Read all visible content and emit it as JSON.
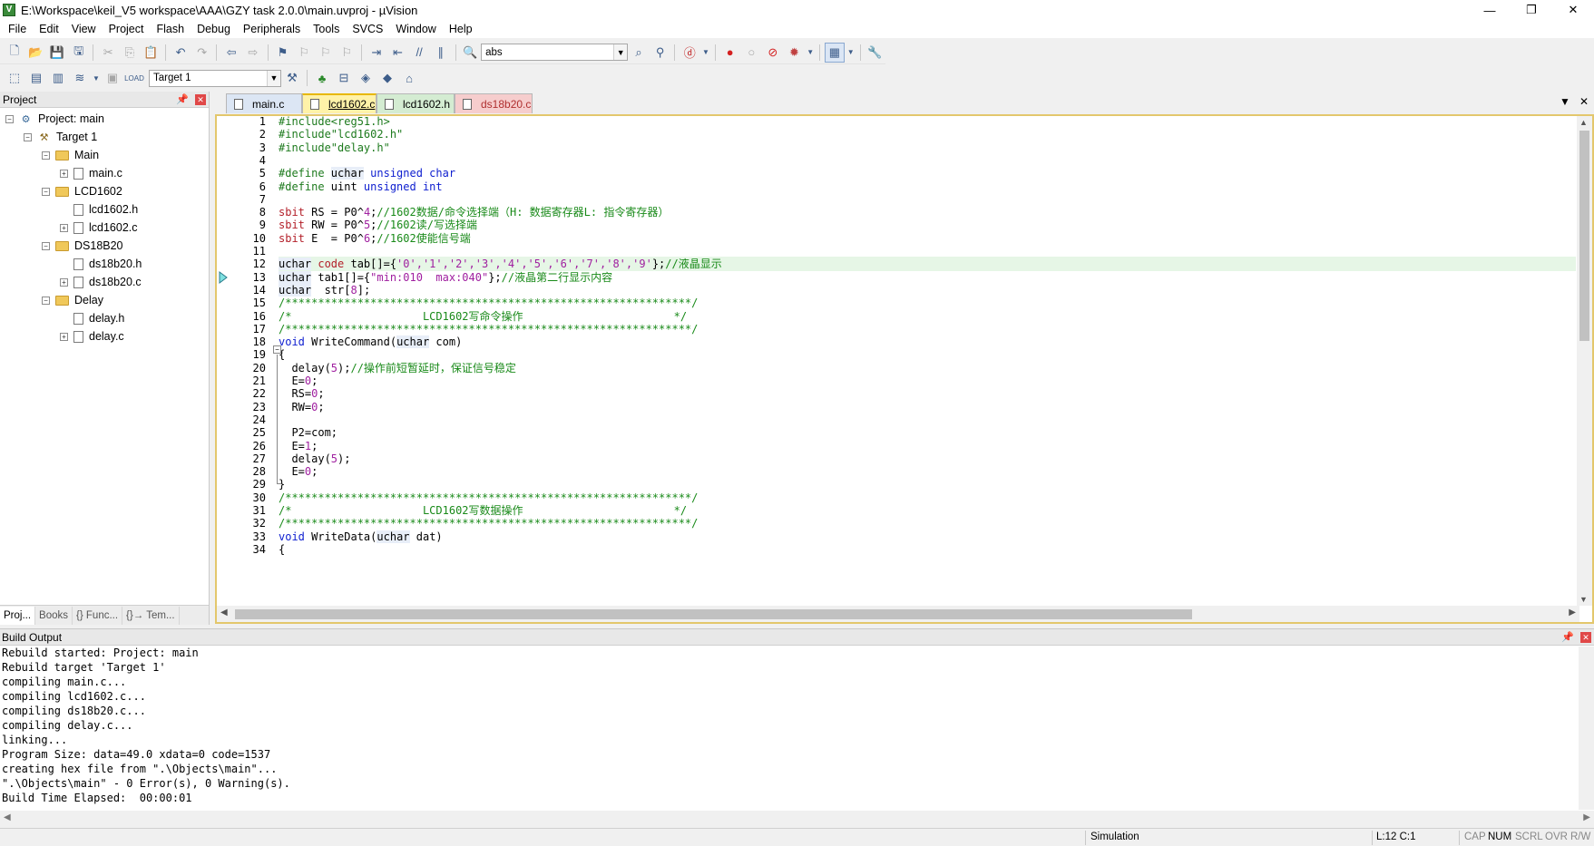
{
  "window": {
    "title": "E:\\Workspace\\keil_V5 workspace\\AAA\\GZY task 2.0.0\\main.uvproj - µVision",
    "minimize": "—",
    "restore": "❐",
    "close": "✕"
  },
  "menu": [
    "File",
    "Edit",
    "View",
    "Project",
    "Flash",
    "Debug",
    "Peripherals",
    "Tools",
    "SVCS",
    "Window",
    "Help"
  ],
  "toolbar": {
    "find_combo_value": "abs",
    "target_combo_value": "Target 1",
    "icons": [
      "new-file-icon",
      "open-icon",
      "save-icon",
      "save-all-icon",
      "cut-icon",
      "copy-icon",
      "paste-icon",
      "undo-icon",
      "redo-icon",
      "nav-back-icon",
      "nav-forward-icon",
      "bookmark-icon",
      "prev-bookmark-icon",
      "next-bookmark-icon",
      "clear-bookmarks-icon",
      "indent-icon",
      "unindent-icon",
      "comment-icon",
      "uncomment-icon",
      "find-in-files-icon"
    ]
  },
  "project_pane": {
    "title": "Project",
    "tree": [
      {
        "label": "Project: main",
        "level": 0,
        "type": "project",
        "expander": "−"
      },
      {
        "label": "Target 1",
        "level": 1,
        "type": "target",
        "expander": "−"
      },
      {
        "label": "Main",
        "level": 2,
        "type": "folder",
        "expander": "−"
      },
      {
        "label": "main.c",
        "level": 3,
        "type": "file",
        "expander": "+"
      },
      {
        "label": "LCD1602",
        "level": 2,
        "type": "folder",
        "expander": "−"
      },
      {
        "label": "lcd1602.h",
        "level": 3,
        "type": "file",
        "expander": ""
      },
      {
        "label": "lcd1602.c",
        "level": 3,
        "type": "file",
        "expander": "+"
      },
      {
        "label": "DS18B20",
        "level": 2,
        "type": "folder",
        "expander": "−"
      },
      {
        "label": "ds18b20.h",
        "level": 3,
        "type": "file",
        "expander": ""
      },
      {
        "label": "ds18b20.c",
        "level": 3,
        "type": "file",
        "expander": "+"
      },
      {
        "label": "Delay",
        "level": 2,
        "type": "folder",
        "expander": "−"
      },
      {
        "label": "delay.h",
        "level": 3,
        "type": "file",
        "expander": ""
      },
      {
        "label": "delay.c",
        "level": 3,
        "type": "file",
        "expander": "+"
      }
    ],
    "bottom_tabs": [
      "Proj...",
      "Books",
      "{} Func...",
      "{}→ Tem..."
    ]
  },
  "editor": {
    "tabs": [
      {
        "label": "main.c",
        "state": "inactive"
      },
      {
        "label": "lcd1602.c",
        "state": "active"
      },
      {
        "label": "lcd1602.h",
        "state": "inactive"
      },
      {
        "label": "ds18b20.c",
        "state": "inactive"
      }
    ],
    "current_line": 12,
    "lines": [
      {
        "n": "1",
        "tokens": [
          [
            "pre",
            "#include<reg51.h>"
          ]
        ]
      },
      {
        "n": "2",
        "tokens": [
          [
            "pre",
            "#include\"lcd1602.h\""
          ]
        ]
      },
      {
        "n": "3",
        "tokens": [
          [
            "pre",
            "#include\"delay.h\""
          ]
        ]
      },
      {
        "n": "4",
        "tokens": []
      },
      {
        "n": "5",
        "tokens": [
          [
            "pre",
            "#define "
          ],
          [
            "typ",
            "uchar"
          ],
          [
            "kw",
            " unsigned char"
          ]
        ]
      },
      {
        "n": "6",
        "tokens": [
          [
            "pre",
            "#define "
          ],
          [
            "blk",
            "uint "
          ],
          [
            "kw",
            "unsigned int"
          ]
        ]
      },
      {
        "n": "7",
        "tokens": []
      },
      {
        "n": "8",
        "tokens": [
          [
            "red",
            "sbit"
          ],
          [
            "blk",
            " RS = P0^"
          ],
          [
            "num",
            "4"
          ],
          [
            "blk",
            ";"
          ],
          [
            "cm",
            "//1602数据/命令选择端（H: 数据寄存器L: 指令寄存器）"
          ]
        ]
      },
      {
        "n": "9",
        "tokens": [
          [
            "red",
            "sbit"
          ],
          [
            "blk",
            " RW = P0^"
          ],
          [
            "num",
            "5"
          ],
          [
            "blk",
            ";"
          ],
          [
            "cm",
            "//1602读/写选择端"
          ]
        ]
      },
      {
        "n": "10",
        "tokens": [
          [
            "red",
            "sbit"
          ],
          [
            "blk",
            " E  = P0^"
          ],
          [
            "num",
            "6"
          ],
          [
            "blk",
            ";"
          ],
          [
            "cm",
            "//1602使能信号端"
          ]
        ]
      },
      {
        "n": "11",
        "tokens": []
      },
      {
        "n": "12",
        "tokens": [
          [
            "typ",
            "uchar"
          ],
          [
            "red",
            " code"
          ],
          [
            "blk",
            " tab[]={"
          ],
          [
            "str",
            "'0','1','2','3','4','5','6','7','8','9'"
          ],
          [
            "blk",
            "};"
          ],
          [
            "cm",
            "//液晶显示"
          ]
        ]
      },
      {
        "n": "13",
        "tokens": [
          [
            "typ",
            "uchar"
          ],
          [
            "blk",
            " tab1[]={"
          ],
          [
            "str",
            "\"min:010  max:040\""
          ],
          [
            "blk",
            "};"
          ],
          [
            "cm",
            "//液晶第二行显示内容"
          ]
        ]
      },
      {
        "n": "14",
        "tokens": [
          [
            "typ",
            "uchar"
          ],
          [
            "blk",
            "  str["
          ],
          [
            "num",
            "8"
          ],
          [
            "blk",
            "];"
          ]
        ]
      },
      {
        "n": "15",
        "tokens": [
          [
            "cm",
            "/**************************************************************/"
          ]
        ]
      },
      {
        "n": "16",
        "tokens": [
          [
            "cm",
            "/*                    LCD1602写命令操作                       */"
          ]
        ]
      },
      {
        "n": "17",
        "tokens": [
          [
            "cm",
            "/**************************************************************/"
          ]
        ]
      },
      {
        "n": "18",
        "tokens": [
          [
            "kw",
            "void"
          ],
          [
            "blk",
            " WriteCommand("
          ],
          [
            "typ",
            "uchar"
          ],
          [
            "blk",
            " com)"
          ]
        ]
      },
      {
        "n": "19",
        "tokens": [
          [
            "blk",
            "{"
          ]
        ]
      },
      {
        "n": "20",
        "tokens": [
          [
            "blk",
            "  delay("
          ],
          [
            "num",
            "5"
          ],
          [
            "blk",
            ");"
          ],
          [
            "cm",
            "//操作前短暂延时，保证信号稳定"
          ]
        ]
      },
      {
        "n": "21",
        "tokens": [
          [
            "blk",
            "  E="
          ],
          [
            "num",
            "0"
          ],
          [
            "blk",
            ";"
          ]
        ]
      },
      {
        "n": "22",
        "tokens": [
          [
            "blk",
            "  RS="
          ],
          [
            "num",
            "0"
          ],
          [
            "blk",
            ";"
          ]
        ]
      },
      {
        "n": "23",
        "tokens": [
          [
            "blk",
            "  RW="
          ],
          [
            "num",
            "0"
          ],
          [
            "blk",
            ";"
          ]
        ]
      },
      {
        "n": "24",
        "tokens": []
      },
      {
        "n": "25",
        "tokens": [
          [
            "blk",
            "  P2=com;"
          ]
        ]
      },
      {
        "n": "26",
        "tokens": [
          [
            "blk",
            "  E="
          ],
          [
            "num",
            "1"
          ],
          [
            "blk",
            ";"
          ]
        ]
      },
      {
        "n": "27",
        "tokens": [
          [
            "blk",
            "  delay("
          ],
          [
            "num",
            "5"
          ],
          [
            "blk",
            ");"
          ]
        ]
      },
      {
        "n": "28",
        "tokens": [
          [
            "blk",
            "  E="
          ],
          [
            "num",
            "0"
          ],
          [
            "blk",
            ";"
          ]
        ]
      },
      {
        "n": "29",
        "tokens": [
          [
            "blk",
            "}"
          ]
        ]
      },
      {
        "n": "30",
        "tokens": [
          [
            "cm",
            "/**************************************************************/"
          ]
        ]
      },
      {
        "n": "31",
        "tokens": [
          [
            "cm",
            "/*                    LCD1602写数据操作                       */"
          ]
        ]
      },
      {
        "n": "32",
        "tokens": [
          [
            "cm",
            "/**************************************************************/"
          ]
        ]
      },
      {
        "n": "33",
        "tokens": [
          [
            "kw",
            "void"
          ],
          [
            "blk",
            " WriteData("
          ],
          [
            "typ",
            "uchar"
          ],
          [
            "blk",
            " dat)"
          ]
        ]
      },
      {
        "n": "34",
        "tokens": [
          [
            "blk",
            "{"
          ]
        ]
      }
    ]
  },
  "build_output": {
    "title": "Build Output",
    "lines": [
      "Rebuild started: Project: main",
      "Rebuild target 'Target 1'",
      "compiling main.c...",
      "compiling lcd1602.c...",
      "compiling ds18b20.c...",
      "compiling delay.c...",
      "linking...",
      "Program Size: data=49.0 xdata=0 code=1537",
      "creating hex file from \".\\Objects\\main\"...",
      "\".\\Objects\\main\" - 0 Error(s), 0 Warning(s).",
      "Build Time Elapsed:  00:00:01"
    ]
  },
  "statusbar": {
    "mode": "Simulation",
    "position": "L:12 C:1",
    "cap": "CAP",
    "num": "NUM",
    "scrl": "SCRL",
    "ovr": "OVR",
    "rw": "R/W"
  },
  "colors": {
    "active_tab": "#fff2a8",
    "current_line": "#e6f6e6",
    "comment": "#198a19",
    "keyword": "#1020d0"
  }
}
